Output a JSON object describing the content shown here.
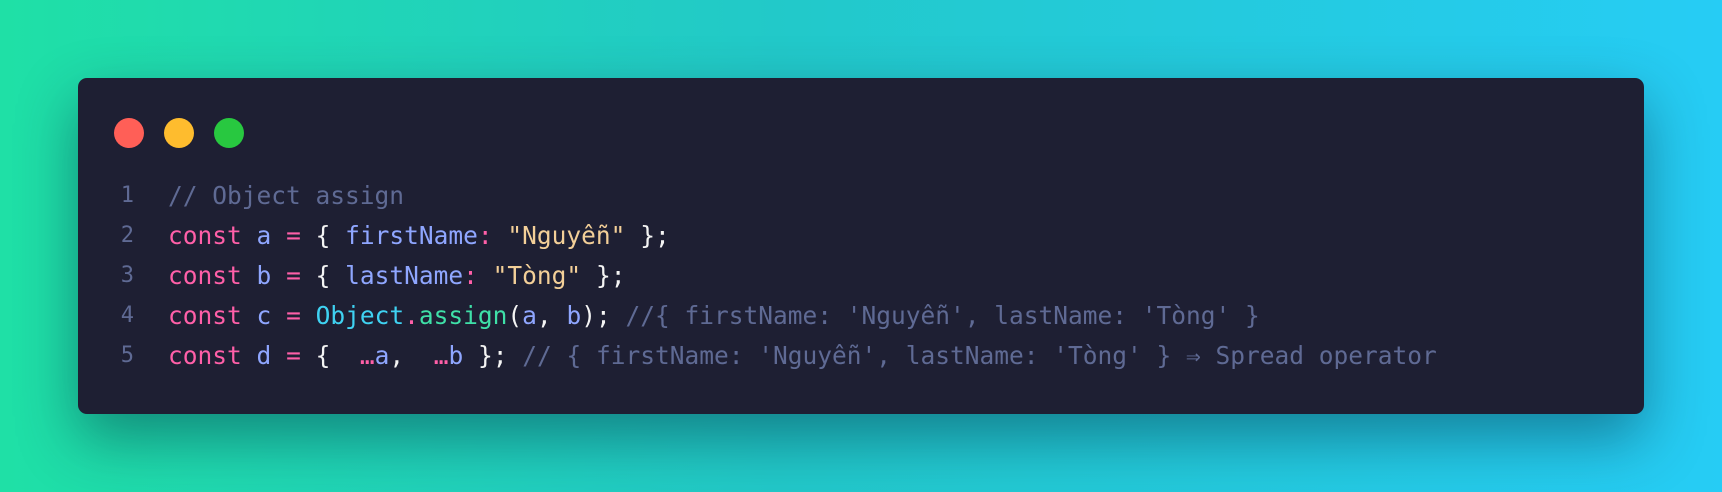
{
  "window": {
    "dots": [
      {
        "name": "close",
        "color": "#ff5f57"
      },
      {
        "name": "minimize",
        "color": "#febc2e"
      },
      {
        "name": "maximize",
        "color": "#28c840"
      }
    ]
  },
  "code": {
    "lines": [
      {
        "number": "1",
        "comment": "// Object assign"
      },
      {
        "number": "2",
        "kw": "const",
        "name": "a",
        "eq": "=",
        "open": "{",
        "prop": "firstName",
        "colon": ":",
        "value": "\"Nguyễn\"",
        "close": "};"
      },
      {
        "number": "3",
        "kw": "const",
        "name": "b",
        "eq": "=",
        "open": "{",
        "prop": "lastName",
        "colon": ":",
        "value": "\"Tòng\"",
        "close": "};"
      },
      {
        "number": "4",
        "kw": "const",
        "name": "c",
        "eq": "=",
        "object": "Object",
        "dot": ".",
        "method": "assign",
        "paren_open": "(",
        "arg1": "a",
        "comma": ",",
        "arg2": "b",
        "paren_close": ");",
        "comment": "//{ firstName: 'Nguyễn', lastName: 'Tòng' }"
      },
      {
        "number": "5",
        "kw": "const",
        "name": "d",
        "eq": "=",
        "open": "{",
        "spread1": "…",
        "arg1": "a",
        "comma": ",",
        "spread2": "…",
        "arg2": "b",
        "close": "};",
        "comment": "// { firstName: 'Nguyễn', lastName: 'Tòng' } ⇒ Spread operator"
      }
    ]
  }
}
